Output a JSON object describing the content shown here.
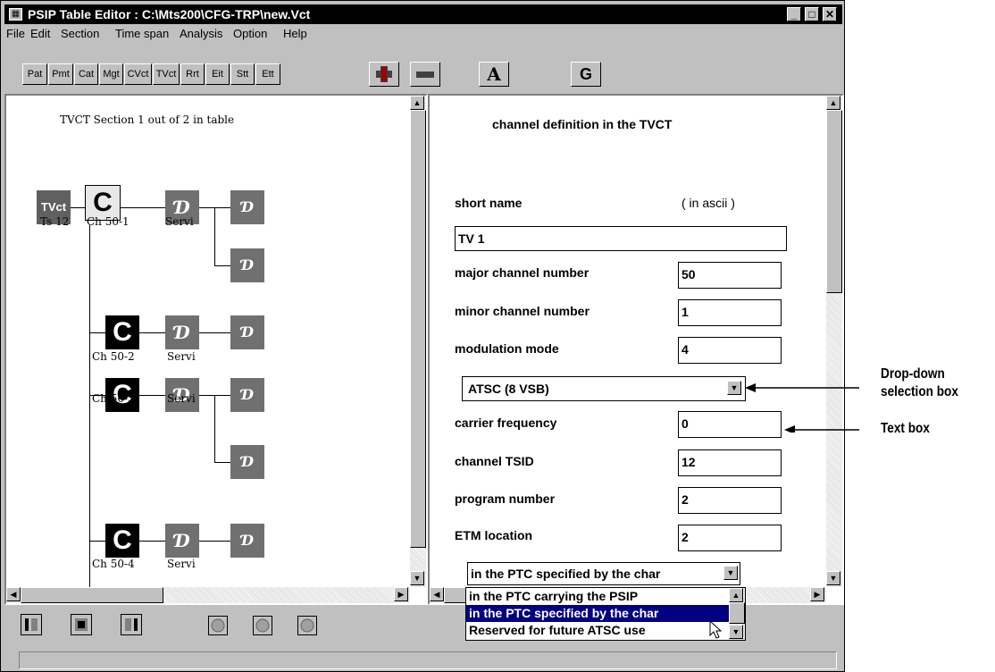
{
  "window": {
    "title": "PSIP Table Editor : C:\\Mts200\\CFG-TRP\\new.Vct"
  },
  "menu": [
    "File",
    "Edit",
    "Section",
    "Time span",
    "Analysis",
    "Option",
    "Help"
  ],
  "toolbar": {
    "tables": [
      "Pat",
      "Pmt",
      "Cat",
      "Mgt",
      "CVct",
      "TVct",
      "Rrt",
      "Eit",
      "Stt",
      "Ett"
    ],
    "add_icon": "plus-icon",
    "remove_icon": "minus-icon",
    "a_label": "A",
    "g_label": "G"
  },
  "tree": {
    "header": "TVCT Section 1 out of 2 in table",
    "root": {
      "label": "TVct",
      "caption": "Ts 12"
    },
    "channels": [
      {
        "glyph": "C",
        "caption": "Ch 50-1",
        "service_caption": "Servi"
      },
      {
        "glyph": "C",
        "caption": "Ch 50-2",
        "service_caption": "Servi"
      },
      {
        "glyph": "C",
        "caption": "Ch 50-3",
        "service_caption": "Servi"
      },
      {
        "glyph": "C",
        "caption": "Ch 50-4",
        "service_caption": "Servi"
      }
    ],
    "service_glyph": "Ɗ",
    "event_glyph": "Ɗ"
  },
  "form": {
    "heading": "channel definition in the TVCT",
    "short_name_label": "short name",
    "short_name_hint": "( in ascii )",
    "short_name_value": "TV 1",
    "major_label": "major channel number",
    "major_value": "50",
    "minor_label": "minor channel number",
    "minor_value": "1",
    "modulation_label": "modulation mode",
    "modulation_value": "4",
    "modulation_select": "ATSC (8 VSB)",
    "carrier_label": "carrier frequency",
    "carrier_value": "0",
    "tsid_label": "channel TSID",
    "tsid_value": "12",
    "program_label": "program number",
    "program_value": "2",
    "etm_label": "ETM location",
    "etm_value": "2",
    "etm_select": "in the PTC specified by the char",
    "etm_options": [
      "in the PTC carrying the PSIP",
      "in the PTC specified by the char",
      "Reserved for future ATSC use"
    ]
  },
  "annotations": {
    "dropdown_line1": "Drop-down",
    "dropdown_line2": "selection box",
    "textbox": "Text box"
  },
  "colors": {
    "title_bg": "#000000",
    "selection_bg": "#000080",
    "chrome": "#c0c0c0"
  }
}
